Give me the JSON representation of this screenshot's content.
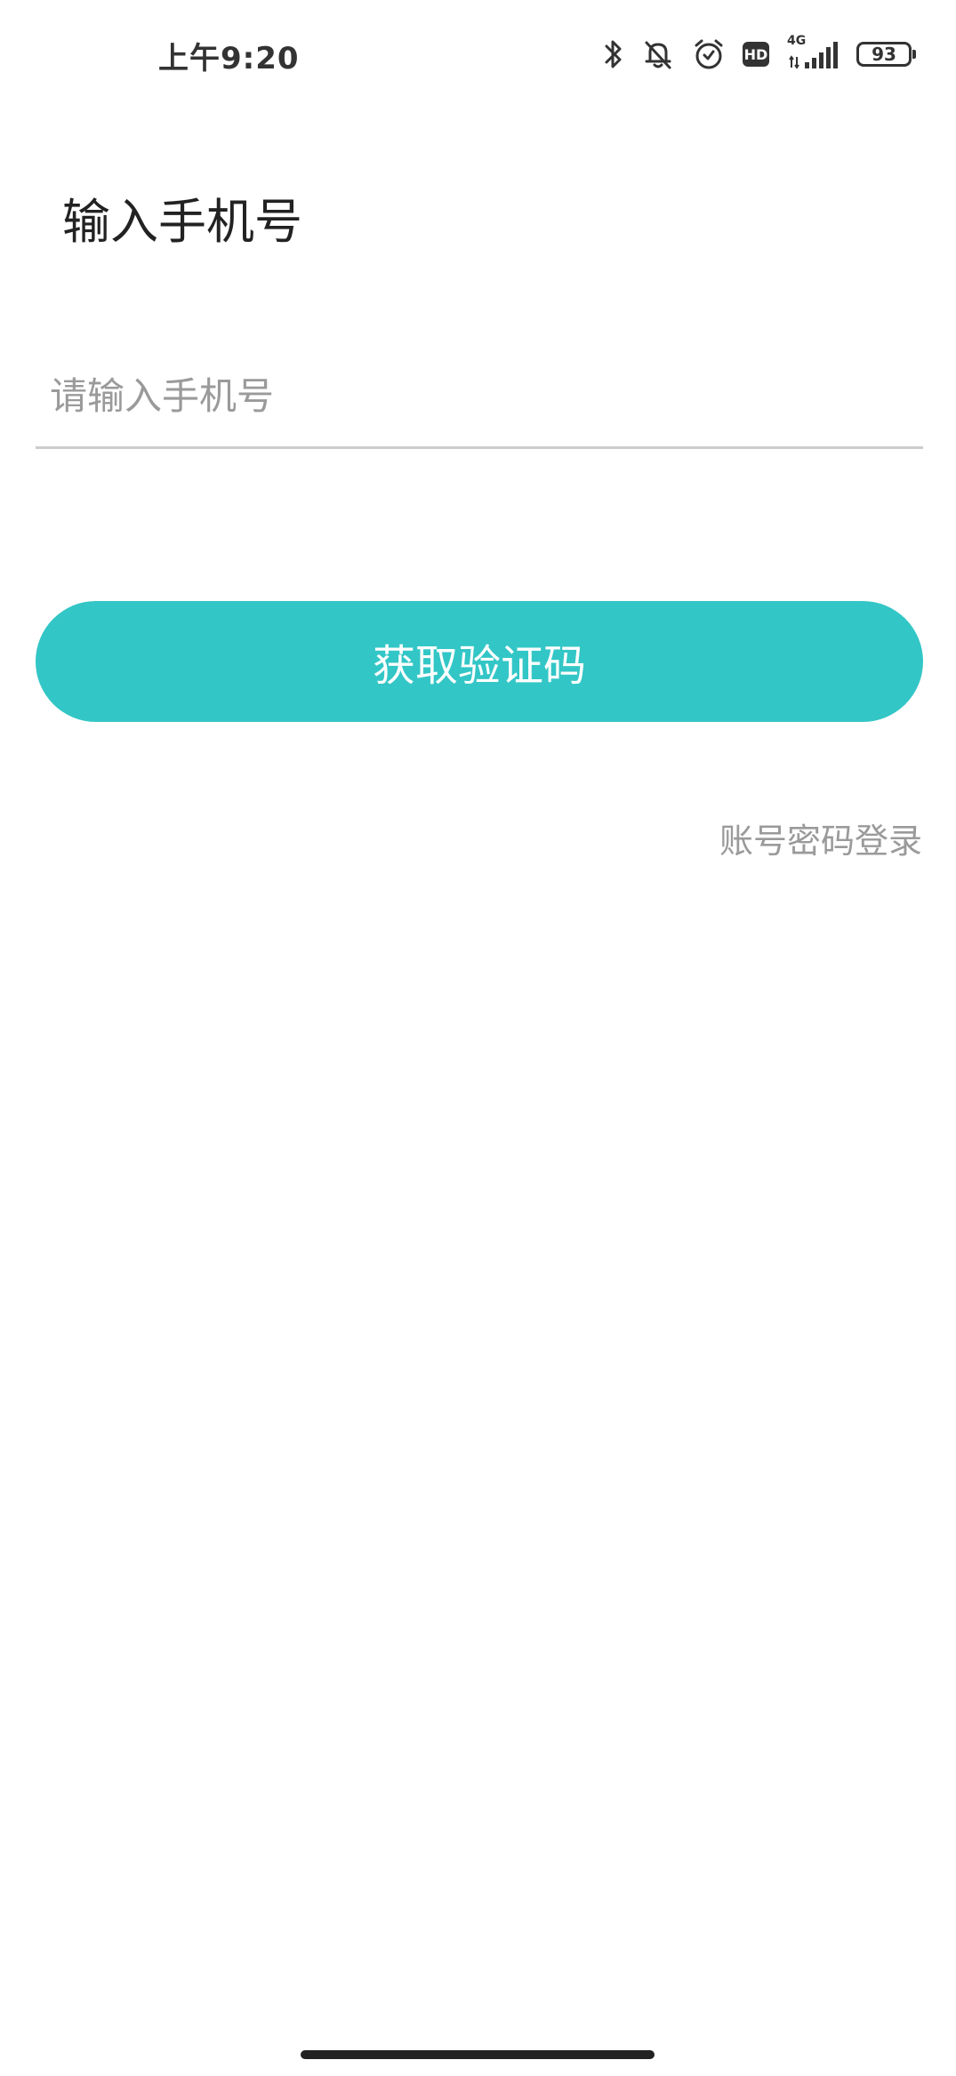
{
  "status_bar": {
    "time": "上午9:20",
    "network_label": "4G",
    "hd_label": "HD",
    "battery_level": "93",
    "icons": [
      "bluetooth-icon",
      "mute-bell-icon",
      "alarm-icon",
      "hd-icon",
      "signal-icon",
      "battery-icon"
    ],
    "icon_color": "#333333"
  },
  "page": {
    "title": "输入手机号"
  },
  "phone_input": {
    "value": "",
    "placeholder": "请输入手机号"
  },
  "primary_button": {
    "label": "获取验证码",
    "color": "#33c6c6"
  },
  "secondary_link": {
    "label": "账号密码登录"
  }
}
